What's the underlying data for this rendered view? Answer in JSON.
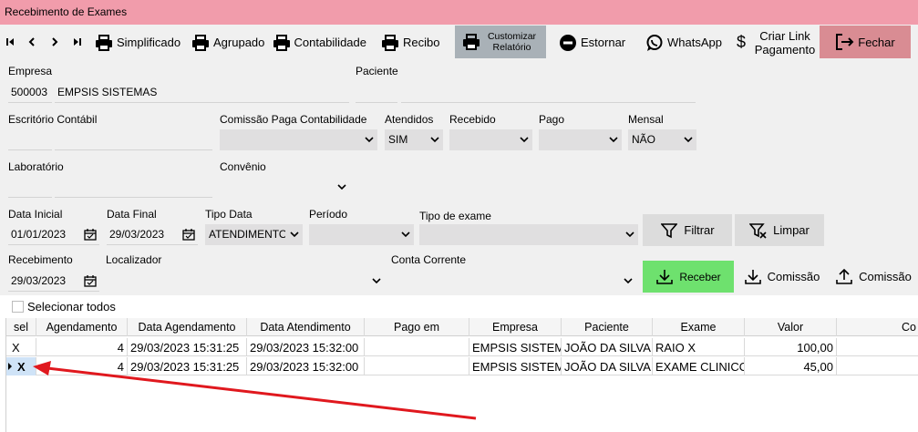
{
  "window": {
    "title": "Recebimento de Exames"
  },
  "toolbar": {
    "simplificado": "Simplificado",
    "agrupado": "Agrupado",
    "contabilidade": "Contabilidade",
    "recibo": "Recibo",
    "customizar": "Customizar Relatório",
    "estornar": "Estornar",
    "whatsapp": "WhatsApp",
    "criar_link": "Criar Link Pagamento",
    "fechar": "Fechar"
  },
  "form": {
    "empresa_label": "Empresa",
    "empresa_code": "500003",
    "empresa_name": "EMPSIS SISTEMAS",
    "paciente_label": "Paciente",
    "escritorio_label": "Escritório Contábil",
    "comissao_label": "Comissão Paga Contabilidade",
    "atendidos_label": "Atendidos",
    "atendidos_value": "SIM",
    "recebido_label": "Recebido",
    "pago_label": "Pago",
    "mensal_label": "Mensal",
    "mensal_value": "NÃO",
    "laboratorio_label": "Laboratório",
    "convenio_label": "Convênio",
    "data_inicial_label": "Data Inicial",
    "data_inicial_value": "01/01/2023",
    "data_final_label": "Data Final",
    "data_final_value": "29/03/2023",
    "tipo_data_label": "Tipo Data",
    "tipo_data_value": "ATENDIMENTO",
    "periodo_label": "Período",
    "tipo_exame_label": "Tipo de exame",
    "filtrar": "Filtrar",
    "limpar": "Limpar",
    "recebimento_label": "Recebimento",
    "recebimento_value": "29/03/2023",
    "localizador_label": "Localizador",
    "conta_corrente_label": "Conta Corrente",
    "receber": "Receber",
    "comissao_down": "Comissão",
    "comissao_up": "Comissão"
  },
  "selecionar_todos": "Selecionar todos",
  "grid": {
    "columns": [
      "sel",
      "Agendamento",
      "Data Agendamento",
      "Data Atendimento",
      "Pago em",
      "Empresa",
      "Paciente",
      "Exame",
      "Valor",
      "Co"
    ],
    "rows": [
      [
        "X",
        "4",
        "29/03/2023 15:31:25",
        "29/03/2023 15:32:00",
        "",
        "EMPSIS SISTEMAS",
        "JOÃO DA SILVA",
        "RAIO X",
        "100,00",
        ""
      ],
      [
        "X",
        "4",
        "29/03/2023 15:31:25",
        "29/03/2023 15:32:00",
        "",
        "EMPSIS SISTEMAS",
        "JOÃO DA SILVA",
        "EXAME CLINICO OCUPACIONAL",
        "45,00",
        ""
      ]
    ]
  },
  "colors": {
    "title_bar": "#f19cab",
    "receber": "#6ee16e",
    "fechar": "#d98c93",
    "arrow": "#e0181e"
  }
}
